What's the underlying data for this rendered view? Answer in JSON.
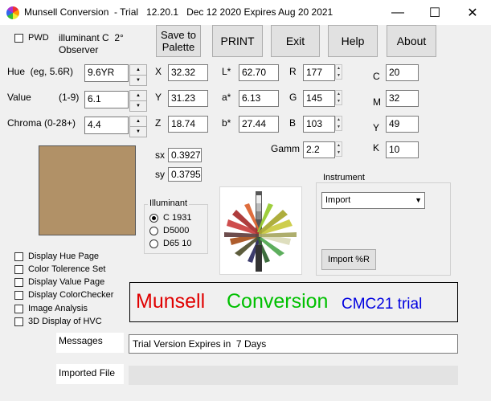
{
  "window": {
    "title": "Munsell Conversion  - Trial   12.20.1   Dec 12 2020 Expires Aug 20 2021",
    "minimize": "—",
    "maximize": "☐",
    "close": "✕"
  },
  "pwd": {
    "label": "PWD",
    "checked": false
  },
  "illuminant_header": {
    "line1": "illuminant C  2°",
    "line2": "Observer"
  },
  "toolbar": {
    "save_palette": "Save to Palette",
    "print": "PRINT",
    "exit": "Exit",
    "help": "Help",
    "about": "About"
  },
  "munsell": {
    "hue_label": "Hue  (eg, 5.6R)",
    "hue_value": "9.6YR",
    "value_label": "Value",
    "value_range": "(1-9)",
    "value_value": "6.1",
    "chroma_label": "Chroma (0-28+)",
    "chroma_value": "4.4"
  },
  "xyz": {
    "x_label": "X",
    "x_value": "32.32",
    "y_label": "Y",
    "y_value": "31.23",
    "z_label": "Z",
    "z_value": "18.74"
  },
  "lab": {
    "l_label": "L*",
    "l_value": "62.70",
    "a_label": "a*",
    "a_value": "6.13",
    "b_label": "b*",
    "b_value": "27.44"
  },
  "rgb": {
    "r_label": "R",
    "r_value": "177",
    "g_label": "G",
    "g_value": "145",
    "b_label": "B",
    "b_value": "103",
    "gamma_label": "Gamm",
    "gamma_value": "2.2"
  },
  "cmyk": {
    "c_label": "C",
    "c_value": "20",
    "m_label": "M",
    "m_value": "32",
    "y_label": "Y",
    "y_value": "49",
    "k_label": "K",
    "k_value": "10"
  },
  "chromaticity": {
    "sx_label": "sx",
    "sx_value": "0.3927",
    "sy_label": "sy",
    "sy_value": "0.3795"
  },
  "swatch_color": "#b19167",
  "illuminant_group": {
    "title": "Illuminant",
    "options": [
      {
        "label": "C 1931",
        "selected": true
      },
      {
        "label": "D5000",
        "selected": false
      },
      {
        "label": "D65 10",
        "selected": false
      }
    ]
  },
  "instrument_group": {
    "title": "Instrument",
    "selected": "Import",
    "import_button": "Import %R"
  },
  "options": [
    {
      "label": "Display Hue Page"
    },
    {
      "label": "Color Tolerence Set"
    },
    {
      "label": "Display Value Page"
    },
    {
      "label": "Display ColorChecker"
    },
    {
      "label": "Image Analysis"
    },
    {
      "label": "3D Display of HVC"
    }
  ],
  "banner": {
    "word1": "Munsell",
    "word1_color": "#e00000",
    "word2": "Conversion",
    "word2_color": "#00c000",
    "word3": "CMC21 trial",
    "word3_color": "#0000e0"
  },
  "messages": {
    "label": "Messages",
    "text": "Trial Version Expires in  7 Days"
  },
  "imported_file": {
    "label": "Imported File",
    "text": ""
  }
}
